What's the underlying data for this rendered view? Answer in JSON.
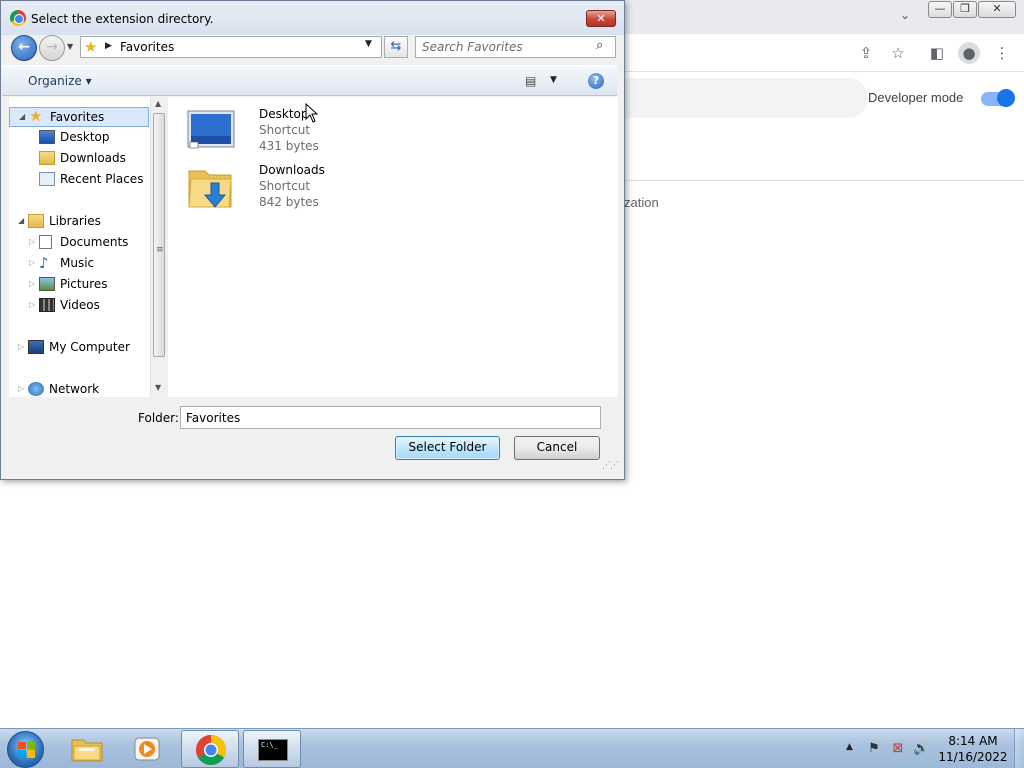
{
  "dialog": {
    "title": "Select the extension directory.",
    "close_label": "✕",
    "address": "Favorites",
    "search_placeholder": "Search Favorites",
    "organize_label": "Organize ▾",
    "help_label": "?",
    "nav_tree": [
      {
        "label": "Favorites",
        "icon": "star-icon",
        "level": 0,
        "expanded": true,
        "selected": true
      },
      {
        "label": "Desktop",
        "icon": "desktop-icon",
        "level": 1
      },
      {
        "label": "Downloads",
        "icon": "downloads-folder-icon",
        "level": 1
      },
      {
        "label": "Recent Places",
        "icon": "recent-places-icon",
        "level": 1
      },
      {
        "label": "Libraries",
        "icon": "libraries-icon",
        "level": 0,
        "expanded": true
      },
      {
        "label": "Documents",
        "icon": "documents-icon",
        "level": 1,
        "collapsed": true
      },
      {
        "label": "Music",
        "icon": "music-icon",
        "level": 1,
        "collapsed": true
      },
      {
        "label": "Pictures",
        "icon": "pictures-icon",
        "level": 1,
        "collapsed": true
      },
      {
        "label": "Videos",
        "icon": "videos-icon",
        "level": 1,
        "collapsed": true
      },
      {
        "label": "My Computer",
        "icon": "computer-icon",
        "level": 0,
        "collapsed": true
      },
      {
        "label": "Network",
        "icon": "network-icon",
        "level": 0,
        "collapsed": true
      }
    ],
    "files": [
      {
        "name": "Desktop",
        "type": "Shortcut",
        "size": "431 bytes",
        "icon": "desktop-shortcut-icon"
      },
      {
        "name": "Downloads",
        "type": "Shortcut",
        "size": "842 bytes",
        "icon": "downloads-shortcut-icon"
      }
    ],
    "folder_label": "Folder:",
    "folder_value": "Favorites",
    "select_button": "Select Folder",
    "cancel_button": "Cancel"
  },
  "chrome": {
    "developer_mode_label": "Developer mode",
    "developer_mode_on": true,
    "partial_text": "zation",
    "accent_color": "#1a73e8"
  },
  "taskbar": {
    "pinned": [
      {
        "name": "windows-explorer",
        "icon": "explorer-icon"
      },
      {
        "name": "media-player",
        "icon": "media-player-icon"
      },
      {
        "name": "chrome",
        "icon": "chrome-icon",
        "active": true
      },
      {
        "name": "command-prompt",
        "icon": "cmd-icon",
        "active": true
      }
    ],
    "cmd_icon_text": "C:\\_",
    "clock_time": "8:14 AM",
    "clock_date": "11/16/2022"
  }
}
